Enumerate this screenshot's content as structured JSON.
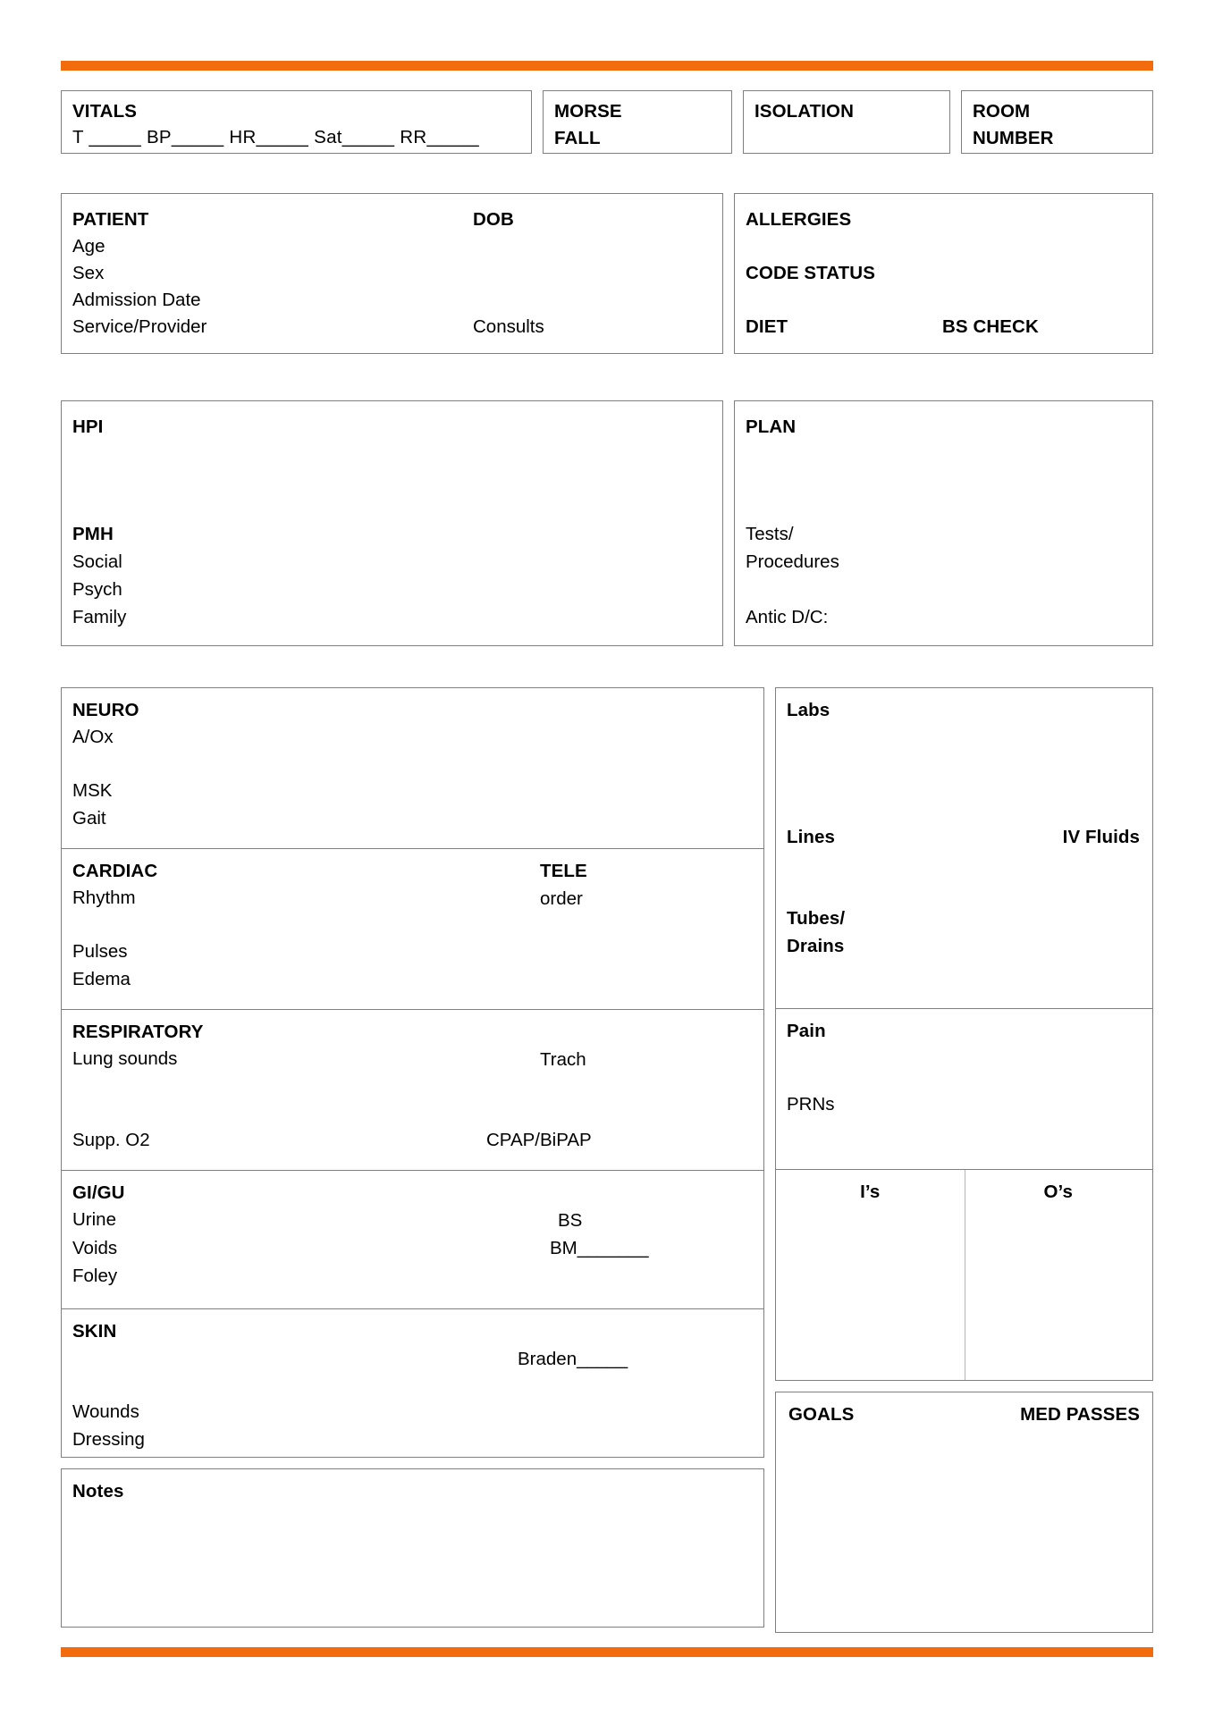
{
  "theme": {
    "accent_orange": "#F26C0D",
    "border_gray": "#7f7f7f",
    "io_divider_blue": "#9dbbd8"
  },
  "top_strip": {
    "vitals": {
      "title": "VITALS",
      "fields_line": "T _____  BP_____   HR_____  Sat_____  RR_____"
    },
    "morse_fall": {
      "line1": "MORSE",
      "line2": "FALL"
    },
    "isolation": {
      "line1": "ISOLATION"
    },
    "room_number": {
      "line1": "ROOM",
      "line2": "NUMBER"
    }
  },
  "patient_strip": {
    "patient": {
      "title": "PATIENT",
      "dob": "DOB",
      "age": "Age",
      "sex": "Sex",
      "admission_date": "Admission Date",
      "service_provider": "Service/Provider",
      "consults": "Consults"
    },
    "allergies": {
      "title": "ALLERGIES",
      "code_status": "CODE STATUS",
      "diet": "DIET",
      "bs_check": "BS CHECK"
    }
  },
  "hpi_strip": {
    "hpi": {
      "title": "HPI",
      "pmh": "PMH",
      "social": "Social",
      "psych": "Psych",
      "family": "Family"
    },
    "plan": {
      "title": "PLAN",
      "tests": "Tests/",
      "procedures": "Procedures",
      "antic_dc": "Antic D/C:"
    }
  },
  "assessment": {
    "neuro": {
      "title": "NEURO",
      "aox": "A/Ox",
      "msk": "MSK",
      "gait": "Gait"
    },
    "cardiac": {
      "title": "CARDIAC",
      "tele": "TELE",
      "order": "order",
      "rhythm": "Rhythm",
      "pulses": "Pulses",
      "edema": "Edema"
    },
    "respiratory": {
      "title": "RESPIRATORY",
      "lung_sounds": "Lung sounds",
      "trach": "Trach",
      "supp_o2": "Supp. O2",
      "cpap_bipap": "CPAP/BiPAP"
    },
    "gi_gu": {
      "title": "GI/GU",
      "urine": "Urine",
      "bs": "BS",
      "voids": "Voids",
      "bm": "BM_______",
      "foley": "Foley"
    },
    "skin": {
      "title": "SKIN",
      "braden": "Braden_____",
      "wounds": "Wounds",
      "dressing": "Dressing"
    },
    "notes": {
      "title": "Notes"
    }
  },
  "right_column": {
    "labs": {
      "title": "Labs",
      "lines": "Lines",
      "iv_fluids": "IV Fluids",
      "tubes": "Tubes/",
      "drains": "Drains"
    },
    "pain": {
      "title": "Pain",
      "prns": "PRNs"
    },
    "intake_output": {
      "intake": "I’s",
      "output": "O’s"
    },
    "goals": {
      "title": "GOALS",
      "med_passes": "MED PASSES"
    }
  }
}
